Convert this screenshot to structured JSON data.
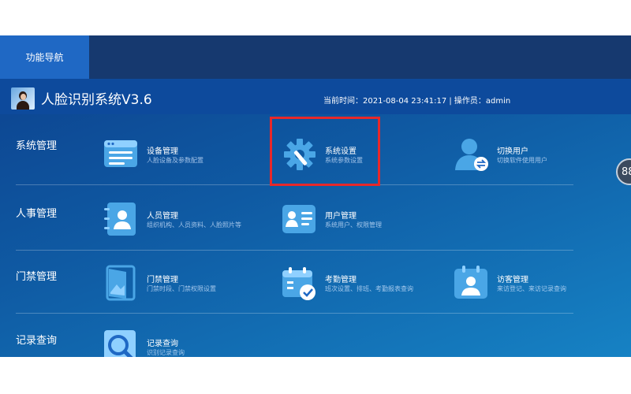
{
  "nav": {
    "tab_label": "功能导航"
  },
  "header": {
    "title": "人脸识别系统V3.6",
    "status": "当前时间：2021-08-04 23:41:17 | 操作员：admin"
  },
  "categories": [
    "系统管理",
    "人事管理",
    "门禁管理",
    "记录查询"
  ],
  "tiles": [
    {
      "title": "设备管理",
      "subtitle": "人脸设备及参数配置",
      "icon": "device-icon"
    },
    {
      "title": "系统设置",
      "subtitle": "系统参数设置",
      "icon": "gear-wrench-icon"
    },
    {
      "title": "切换用户",
      "subtitle": "切换软件使用用户",
      "icon": "switch-user-icon"
    },
    {
      "title": "人员管理",
      "subtitle": "组织机构、人员资料、人脸照片等",
      "icon": "contacts-icon"
    },
    {
      "title": "用户管理",
      "subtitle": "系统用户、权限管理",
      "icon": "id-card-icon"
    },
    {
      "title": "门禁管理",
      "subtitle": "门禁时段、门禁权限设置",
      "icon": "door-icon"
    },
    {
      "title": "考勤管理",
      "subtitle": "班次设置、排班、考勤报表查询",
      "icon": "attendance-calendar-icon"
    },
    {
      "title": "访客管理",
      "subtitle": "来访登记、来访记录查询",
      "icon": "visitor-icon"
    },
    {
      "title": "记录查询",
      "subtitle": "识别记录查询",
      "icon": "search-record-icon"
    }
  ],
  "side_button": {
    "label": "88"
  },
  "colors": {
    "accent": "#1f68c4",
    "highlight": "#e8282a",
    "icon": "#4aa6e6"
  }
}
